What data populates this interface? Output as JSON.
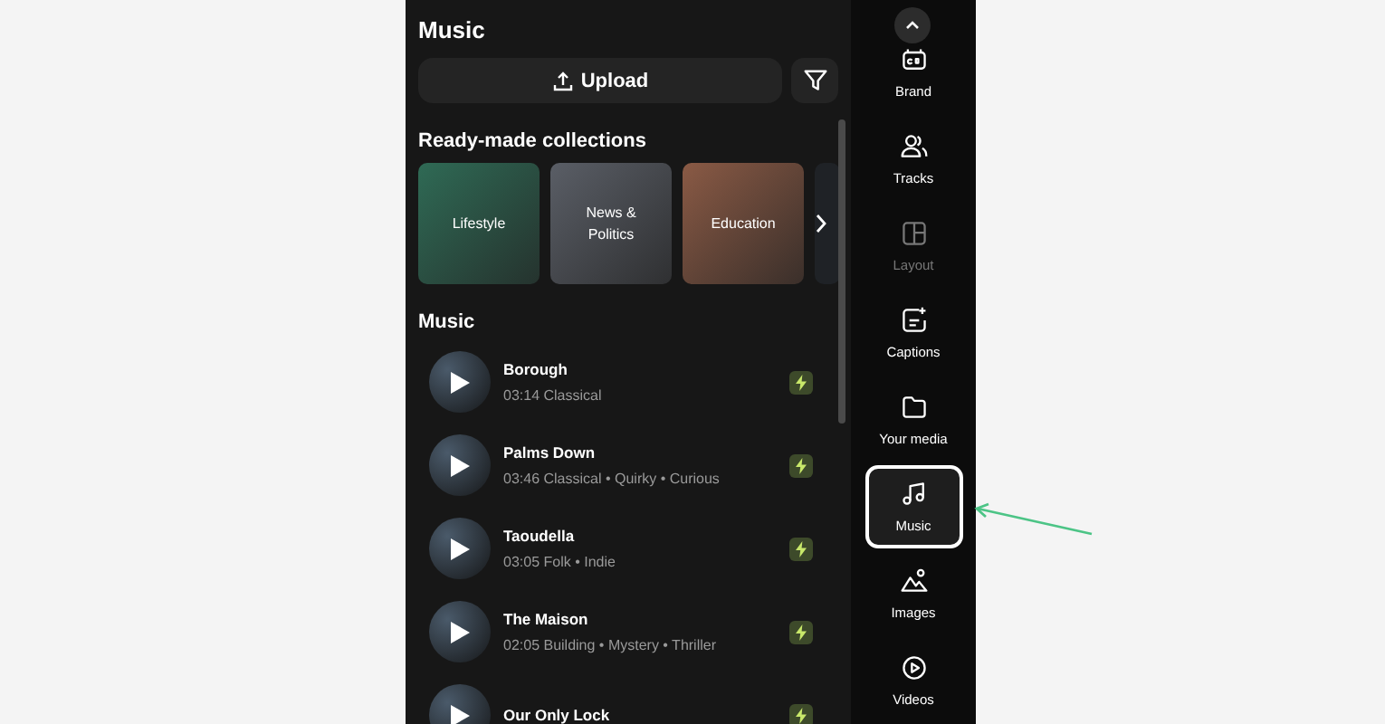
{
  "panel": {
    "title": "Music",
    "upload_button": "Upload",
    "collections_heading": "Ready-made collections",
    "collections": [
      {
        "label": "Lifestyle",
        "color": "#2f6a55"
      },
      {
        "label": "News & Politics",
        "color": "#5a5e66"
      },
      {
        "label": "Education",
        "color": "#8a5a45"
      }
    ],
    "music_heading": "Music",
    "tracks": [
      {
        "title": "Borough",
        "meta": "03:14 Classical"
      },
      {
        "title": "Palms Down",
        "meta": "03:46 Classical • Quirky • Curious"
      },
      {
        "title": "Taoudella",
        "meta": "03:05 Folk • Indie"
      },
      {
        "title": "The Maison",
        "meta": "02:05 Building • Mystery • Thriller"
      },
      {
        "title": "Our Only Lock"
      }
    ]
  },
  "sidebar": {
    "items": [
      {
        "label": "Brand",
        "selected": false,
        "disabled": false
      },
      {
        "label": "Tracks",
        "selected": false,
        "disabled": false
      },
      {
        "label": "Layout",
        "selected": false,
        "disabled": true
      },
      {
        "label": "Captions",
        "selected": false,
        "disabled": false
      },
      {
        "label": "Your media",
        "selected": false,
        "disabled": false
      },
      {
        "label": "Music",
        "selected": true,
        "disabled": false
      },
      {
        "label": "Images",
        "selected": false,
        "disabled": false
      },
      {
        "label": "Videos",
        "selected": false,
        "disabled": false
      }
    ]
  }
}
